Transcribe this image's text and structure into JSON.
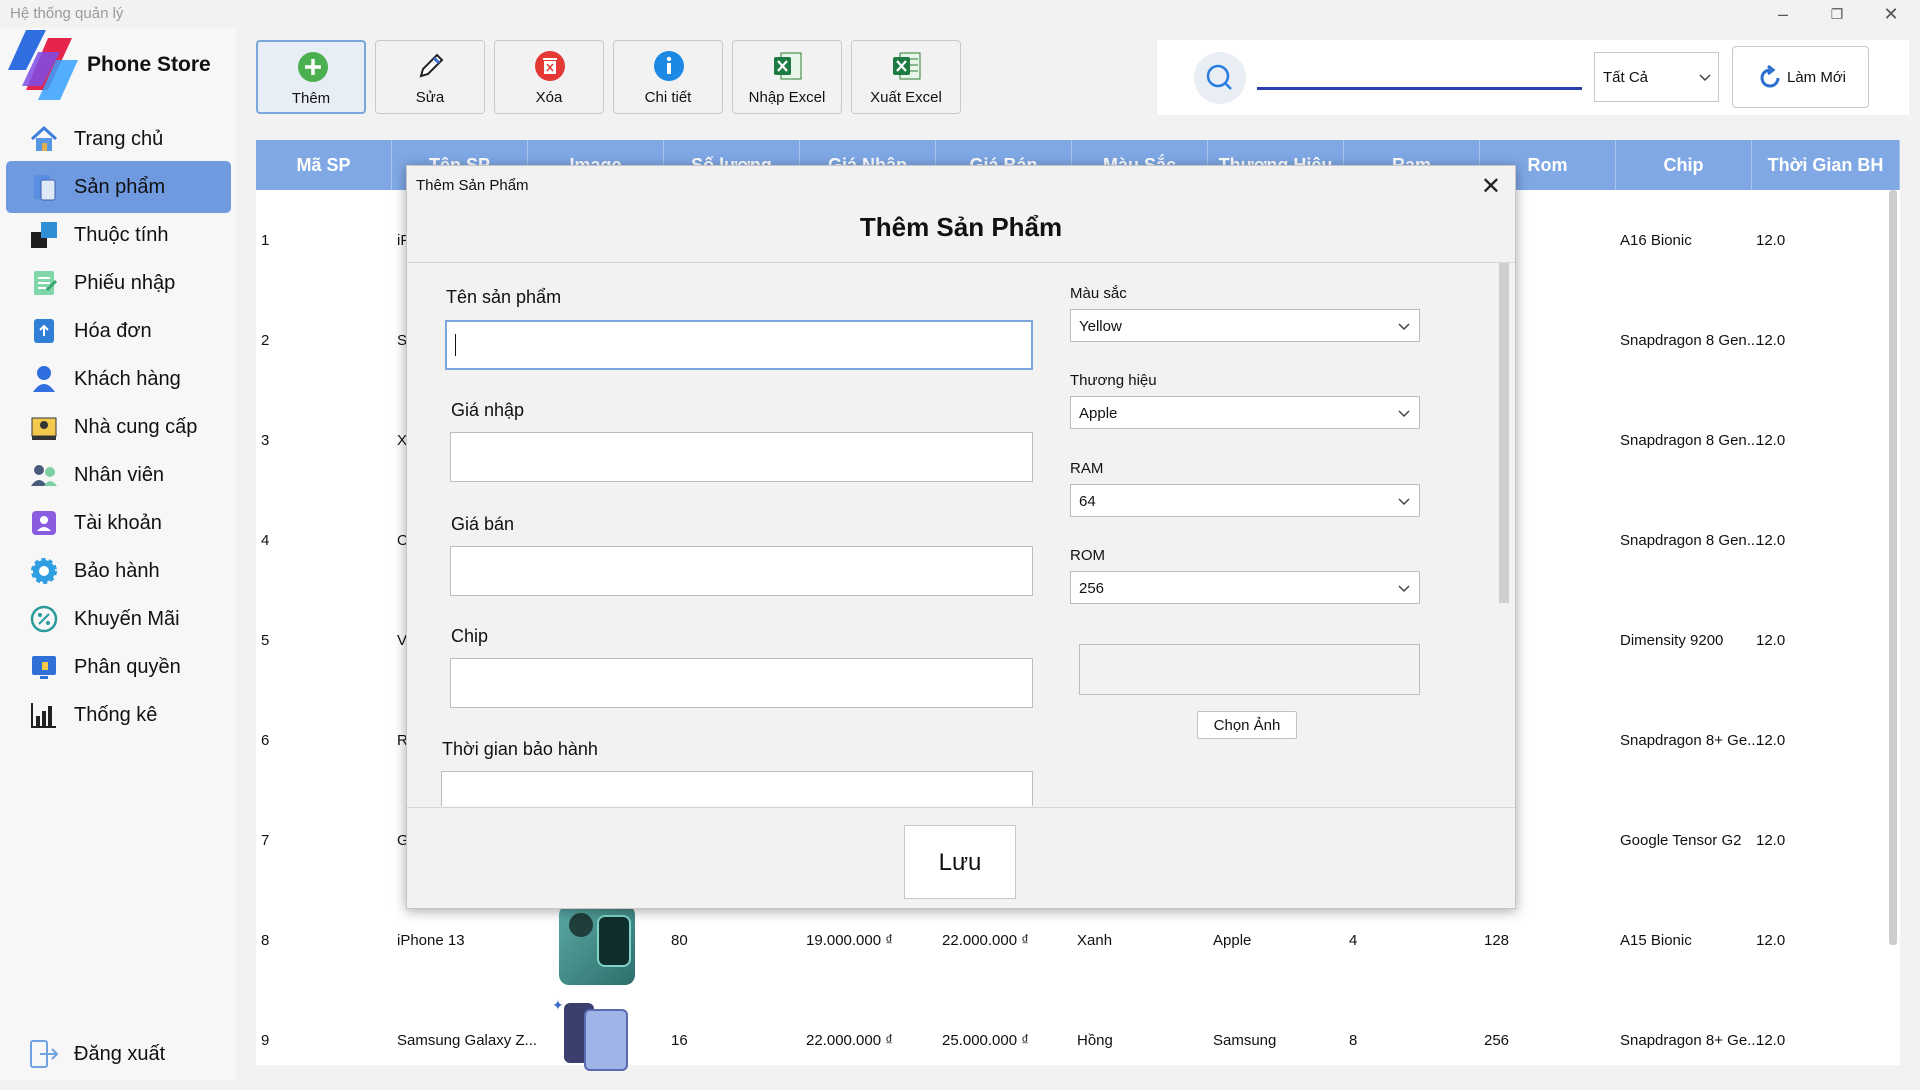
{
  "window": {
    "title": "Hệ thống quản lý"
  },
  "app": {
    "brand": "Phone Store"
  },
  "sidebar": {
    "items": [
      {
        "label": "Trang chủ",
        "icon": "home-icon",
        "active": false
      },
      {
        "label": "Sản phẩm",
        "icon": "phone-icon",
        "active": true
      },
      {
        "label": "Thuộc tính",
        "icon": "attributes-icon",
        "active": false
      },
      {
        "label": "Phiếu nhập",
        "icon": "receipt-icon",
        "active": false
      },
      {
        "label": "Hóa đơn",
        "icon": "invoice-icon",
        "active": false
      },
      {
        "label": "Khách hàng",
        "icon": "customer-icon",
        "active": false
      },
      {
        "label": "Nhà cung cấp",
        "icon": "supplier-icon",
        "active": false
      },
      {
        "label": "Nhân viên",
        "icon": "staff-icon",
        "active": false
      },
      {
        "label": "Tài khoản",
        "icon": "account-icon",
        "active": false
      },
      {
        "label": "Bảo hành",
        "icon": "warranty-gear-icon",
        "active": false
      },
      {
        "label": "Khuyến Mãi",
        "icon": "discount-icon",
        "active": false
      },
      {
        "label": "Phân quyền",
        "icon": "permission-icon",
        "active": false
      },
      {
        "label": "Thống kê",
        "icon": "stats-chart-icon",
        "active": false
      }
    ],
    "logout": "Đăng xuất"
  },
  "toolbar": {
    "buttons": [
      {
        "label": "Thêm",
        "icon": "add-plus-icon"
      },
      {
        "label": "Sửa",
        "icon": "edit-pencil-icon"
      },
      {
        "label": "Xóa",
        "icon": "delete-trash-icon"
      },
      {
        "label": "Chi tiết",
        "icon": "info-icon"
      },
      {
        "label": "Nhập Excel",
        "icon": "excel-import-icon"
      },
      {
        "label": "Xuất Excel",
        "icon": "excel-export-icon"
      }
    ],
    "search_value": "",
    "filter": "Tất Cả",
    "refresh": "Làm Mới"
  },
  "table": {
    "columns": [
      "Mã SP",
      "Tên SP",
      "Image",
      "Số lượng",
      "Giá Nhập",
      "Giá Bán",
      "Màu Sắc",
      "Thương Hiệu",
      "Ram",
      "Rom",
      "Chip",
      "Thời Gian BH"
    ],
    "rows": [
      {
        "id": "1",
        "name": "iP",
        "qty": "",
        "cost": "",
        "price": "",
        "color": "",
        "brand": "",
        "ram": "",
        "rom": "",
        "chip": "A16 Bionic",
        "warranty": "12.0"
      },
      {
        "id": "2",
        "name": "S",
        "qty": "",
        "cost": "",
        "price": "",
        "color": "",
        "brand": "",
        "ram": "",
        "rom": "",
        "chip": "Snapdragon 8 Gen...",
        "warranty": "12.0"
      },
      {
        "id": "3",
        "name": "X",
        "qty": "",
        "cost": "",
        "price": "",
        "color": "",
        "brand": "",
        "ram": "",
        "rom": "",
        "chip": "Snapdragon 8 Gen...",
        "warranty": "12.0"
      },
      {
        "id": "4",
        "name": "O",
        "qty": "",
        "cost": "",
        "price": "",
        "color": "",
        "brand": "",
        "ram": "",
        "rom": "",
        "chip": "Snapdragon 8 Gen...",
        "warranty": "12.0"
      },
      {
        "id": "5",
        "name": "V",
        "qty": "",
        "cost": "",
        "price": "",
        "color": "",
        "brand": "",
        "ram": "",
        "rom": "",
        "chip": "Dimensity 9200",
        "warranty": "12.0"
      },
      {
        "id": "6",
        "name": "R",
        "qty": "",
        "cost": "",
        "price": "",
        "color": "",
        "brand": "",
        "ram": "",
        "rom": "",
        "chip": "Snapdragon 8+ Ge...",
        "warranty": "12.0"
      },
      {
        "id": "7",
        "name": "G",
        "qty": "",
        "cost": "",
        "price": "",
        "color": "",
        "brand": "",
        "ram": "",
        "rom": "",
        "chip": "Google Tensor G2",
        "warranty": "12.0"
      },
      {
        "id": "8",
        "name": "iPhone 13",
        "qty": "80",
        "cost": "19.000.000 ₫",
        "price": "22.000.000 ₫",
        "color": "Xanh",
        "brand": "Apple",
        "ram": "4",
        "rom": "128",
        "chip": "A15 Bionic",
        "warranty": "12.0"
      },
      {
        "id": "9",
        "name": "Samsung Galaxy Z...",
        "qty": "16",
        "cost": "22.000.000 ₫",
        "price": "25.000.000 ₫",
        "color": "Hồng",
        "brand": "Samsung",
        "ram": "8",
        "rom": "256",
        "chip": "Snapdragon 8+ Ge...",
        "warranty": "12.0"
      }
    ]
  },
  "dialog": {
    "window_title": "Thêm Sản Phẩm",
    "heading": "Thêm Sản Phẩm",
    "fields": {
      "name_label": "Tên sản phẩm",
      "cost_label": "Giá nhập",
      "price_label": "Giá bán",
      "chip_label": "Chip",
      "warranty_label": "Thời gian bảo hành"
    },
    "selects": {
      "color_label": "Màu sắc",
      "color_value": "Yellow",
      "brand_label": "Thương hiệu",
      "brand_value": "Apple",
      "ram_label": "RAM",
      "ram_value": "64",
      "rom_label": "ROM",
      "rom_value": "256"
    },
    "choose_image": "Chọn Ảnh",
    "save": "Lưu"
  },
  "colors": {
    "accent": "#6f9ae0",
    "header": "#7fa8e5",
    "search_line": "#2a3fb0"
  }
}
